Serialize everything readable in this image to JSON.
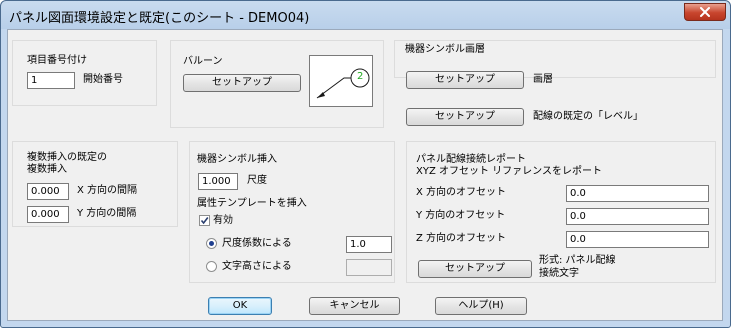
{
  "window": {
    "title": "パネル図面環境設定と既定(このシート - DEMO04)"
  },
  "item_number": {
    "heading": "項目番号付け",
    "start_value": "1",
    "start_label": "開始番号"
  },
  "balloon": {
    "heading": "バルーン",
    "setup_label": "セットアップ",
    "preview_number": "2"
  },
  "device_layer": {
    "heading": "機器シンボル画層",
    "setup_label": "セットアップ",
    "layer_label": "画層",
    "wire_setup_label": "セットアップ",
    "wire_label": "配線の既定の「レベル」"
  },
  "multi_insert": {
    "heading_line1": "複数挿入の既定の",
    "heading_line2": "複数挿入",
    "x_value": "0.000",
    "x_label": "X 方向の間隔",
    "y_value": "0.000",
    "y_label": "Y 方向の間隔"
  },
  "device_insert": {
    "heading": "機器シンボル挿入",
    "scale_value": "1.000",
    "scale_label": "尺度",
    "attr_heading": "属性テンプレートを挿入",
    "enabled_label": "有効",
    "enabled_checked": true,
    "radio_scale_label": "尺度係数による",
    "radio_scale_value": "1.0",
    "radio_text_label": "文字高さによる",
    "radio_text_value": ""
  },
  "report": {
    "heading_line1": "パネル配線接続レポート",
    "heading_line2": "XYZ オフセット リファレンスをレポート",
    "x_label": "X 方向のオフセット",
    "x_value": "0.0",
    "y_label": "Y 方向のオフセット",
    "y_value": "0.0",
    "z_label": "Z 方向のオフセット",
    "z_value": "0.0",
    "setup_label": "セットアップ",
    "format_line1": "形式: パネル配線",
    "format_line2": "接続文字"
  },
  "footer": {
    "ok_label": "OK",
    "cancel_label": "キャンセル",
    "help_label": "ヘルプ(H)"
  },
  "colors": {
    "preview_circle": "#1a1a1a",
    "preview_number": "#22aa22",
    "default_button_border": "#3c7fb1",
    "close_button": "#c8452d"
  },
  "icons": {
    "close": "close-icon",
    "check": "check-icon"
  }
}
